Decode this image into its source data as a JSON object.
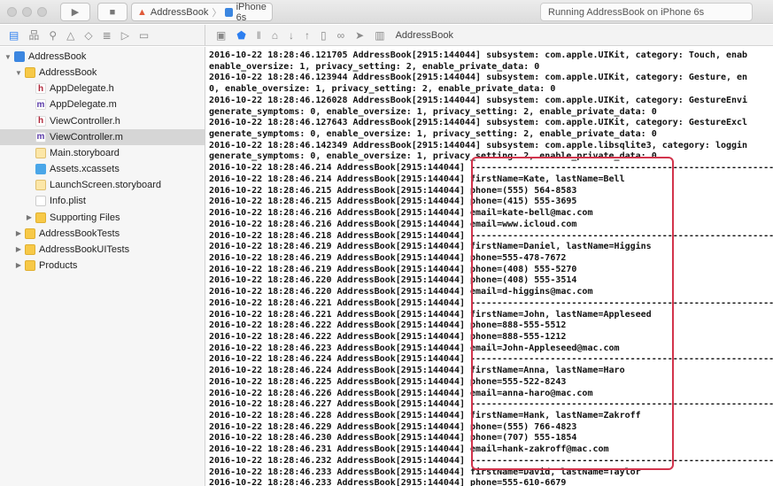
{
  "toolbar": {
    "scheme_project": "AddressBook",
    "scheme_device": "iPhone 6s",
    "status": "Running AddressBook on iPhone 6s",
    "run_icon": "play-icon",
    "stop_icon": "stop-icon"
  },
  "debugbar": {
    "target": "AddressBook"
  },
  "navigator": {
    "tree": [
      {
        "label": "AddressBook",
        "icon": "proj",
        "depth": 0,
        "tri": "▼"
      },
      {
        "label": "AddressBook",
        "icon": "folder",
        "depth": 1,
        "tri": "▼"
      },
      {
        "label": "AppDelegate.h",
        "icon": "h",
        "depth": 2,
        "tri": ""
      },
      {
        "label": "AppDelegate.m",
        "icon": "m",
        "depth": 2,
        "tri": ""
      },
      {
        "label": "ViewController.h",
        "icon": "h",
        "depth": 2,
        "tri": ""
      },
      {
        "label": "ViewController.m",
        "icon": "m",
        "depth": 2,
        "tri": "",
        "selected": true
      },
      {
        "label": "Main.storyboard",
        "icon": "sb",
        "depth": 2,
        "tri": ""
      },
      {
        "label": "Assets.xcassets",
        "icon": "assets",
        "depth": 2,
        "tri": ""
      },
      {
        "label": "LaunchScreen.storyboard",
        "icon": "sb",
        "depth": 2,
        "tri": ""
      },
      {
        "label": "Info.plist",
        "icon": "plist",
        "depth": 2,
        "tri": ""
      },
      {
        "label": "Supporting Files",
        "icon": "folder",
        "depth": 2,
        "tri": "▶"
      },
      {
        "label": "AddressBookTests",
        "icon": "folder",
        "depth": 1,
        "tri": "▶"
      },
      {
        "label": "AddressBookUITests",
        "icon": "folder",
        "depth": 1,
        "tri": "▶"
      },
      {
        "label": "Products",
        "icon": "folder",
        "depth": 1,
        "tri": "▶"
      }
    ]
  },
  "console": {
    "lines": [
      "2016-10-22 18:28:46.121705 AddressBook[2915:144044] subsystem: com.apple.UIKit, category: Touch, enab",
      "enable_oversize: 1, privacy_setting: 2, enable_private_data: 0",
      "2016-10-22 18:28:46.123944 AddressBook[2915:144044] subsystem: com.apple.UIKit, category: Gesture, en",
      "0, enable_oversize: 1, privacy_setting: 2, enable_private_data: 0",
      "2016-10-22 18:28:46.126028 AddressBook[2915:144044] subsystem: com.apple.UIKit, category: GestureEnvi",
      "generate_symptoms: 0, enable_oversize: 1, privacy_setting: 2, enable_private_data: 0",
      "2016-10-22 18:28:46.127643 AddressBook[2915:144044] subsystem: com.apple.UIKit, category: GestureExcl",
      "generate_symptoms: 0, enable_oversize: 1, privacy_setting: 2, enable_private_data: 0",
      "2016-10-22 18:28:46.142349 AddressBook[2915:144044] subsystem: com.apple.libsqlite3, category: loggin",
      "generate_symptoms: 0, enable_oversize: 1, privacy_setting: 2, enable_private_data: 0",
      "2016-10-22 18:28:46.214 AddressBook[2915:144044] ------------------------------------------------------------",
      "2016-10-22 18:28:46.214 AddressBook[2915:144044] firstName=Kate, lastName=Bell",
      "2016-10-22 18:28:46.215 AddressBook[2915:144044] phone=(555) 564-8583",
      "2016-10-22 18:28:46.215 AddressBook[2915:144044] phone=(415) 555-3695",
      "2016-10-22 18:28:46.216 AddressBook[2915:144044] email=kate-bell@mac.com",
      "2016-10-22 18:28:46.216 AddressBook[2915:144044] email=www.icloud.com",
      "2016-10-22 18:28:46.218 AddressBook[2915:144044] ------------------------------------------------------------",
      "2016-10-22 18:28:46.219 AddressBook[2915:144044] firstName=Daniel, lastName=Higgins",
      "2016-10-22 18:28:46.219 AddressBook[2915:144044] phone=555-478-7672",
      "2016-10-22 18:28:46.219 AddressBook[2915:144044] phone=(408) 555-5270",
      "2016-10-22 18:28:46.220 AddressBook[2915:144044] phone=(408) 555-3514",
      "2016-10-22 18:28:46.220 AddressBook[2915:144044] email=d-higgins@mac.com",
      "2016-10-22 18:28:46.221 AddressBook[2915:144044] ------------------------------------------------------------",
      "2016-10-22 18:28:46.221 AddressBook[2915:144044] firstName=John, lastName=Appleseed",
      "2016-10-22 18:28:46.222 AddressBook[2915:144044] phone=888-555-5512",
      "2016-10-22 18:28:46.222 AddressBook[2915:144044] phone=888-555-1212",
      "2016-10-22 18:28:46.223 AddressBook[2915:144044] email=John-Appleseed@mac.com",
      "2016-10-22 18:28:46.224 AddressBook[2915:144044] ------------------------------------------------------------",
      "2016-10-22 18:28:46.224 AddressBook[2915:144044] firstName=Anna, lastName=Haro",
      "2016-10-22 18:28:46.225 AddressBook[2915:144044] phone=555-522-8243",
      "2016-10-22 18:28:46.226 AddressBook[2915:144044] email=anna-haro@mac.com",
      "2016-10-22 18:28:46.227 AddressBook[2915:144044] ------------------------------------------------------------",
      "2016-10-22 18:28:46.228 AddressBook[2915:144044] firstName=Hank, lastName=Zakroff",
      "2016-10-22 18:28:46.229 AddressBook[2915:144044] phone=(555) 766-4823",
      "2016-10-22 18:28:46.230 AddressBook[2915:144044] phone=(707) 555-1854",
      "2016-10-22 18:28:46.231 AddressBook[2915:144044] email=hank-zakroff@mac.com",
      "2016-10-22 18:28:46.232 AddressBook[2915:144044] ------------------------------------------------------------",
      "2016-10-22 18:28:46.233 AddressBook[2915:144044] firstName=David, lastName=Taylor",
      "2016-10-22 18:28:46.233 AddressBook[2915:144044] phone=555-610-6679"
    ]
  },
  "colors": {
    "highlight_box": "#d2344c",
    "accent": "#2d7ff0"
  }
}
